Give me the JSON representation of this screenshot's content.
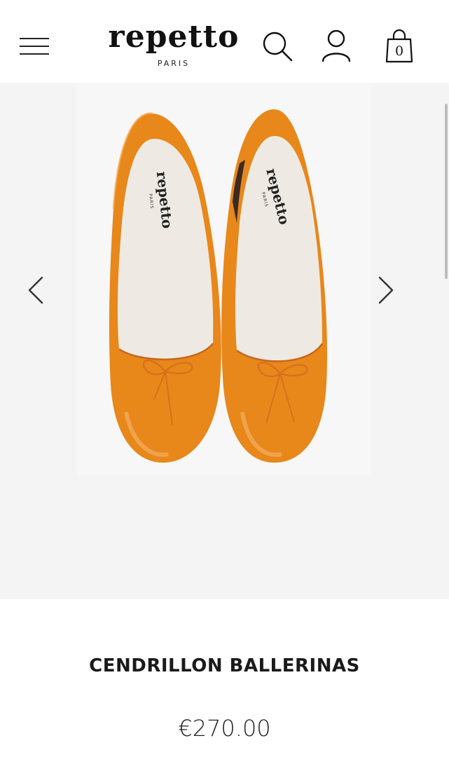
{
  "header": {
    "logo_text": "repetto",
    "logo_subtext": "PARIS",
    "menu_icon": "hamburger-menu-icon",
    "search_icon": "search-icon",
    "account_icon": "user-icon",
    "bag_icon": "shopping-bag-icon",
    "bag_count": "0"
  },
  "gallery": {
    "prev_icon": "chevron-left-icon",
    "next_icon": "chevron-right-icon",
    "insole_brand": "repetto",
    "insole_sub": "PARIS",
    "shoe_color": "#e8871a"
  },
  "product": {
    "name": "CENDRILLON BALLERINAS",
    "price": "€270.00"
  }
}
